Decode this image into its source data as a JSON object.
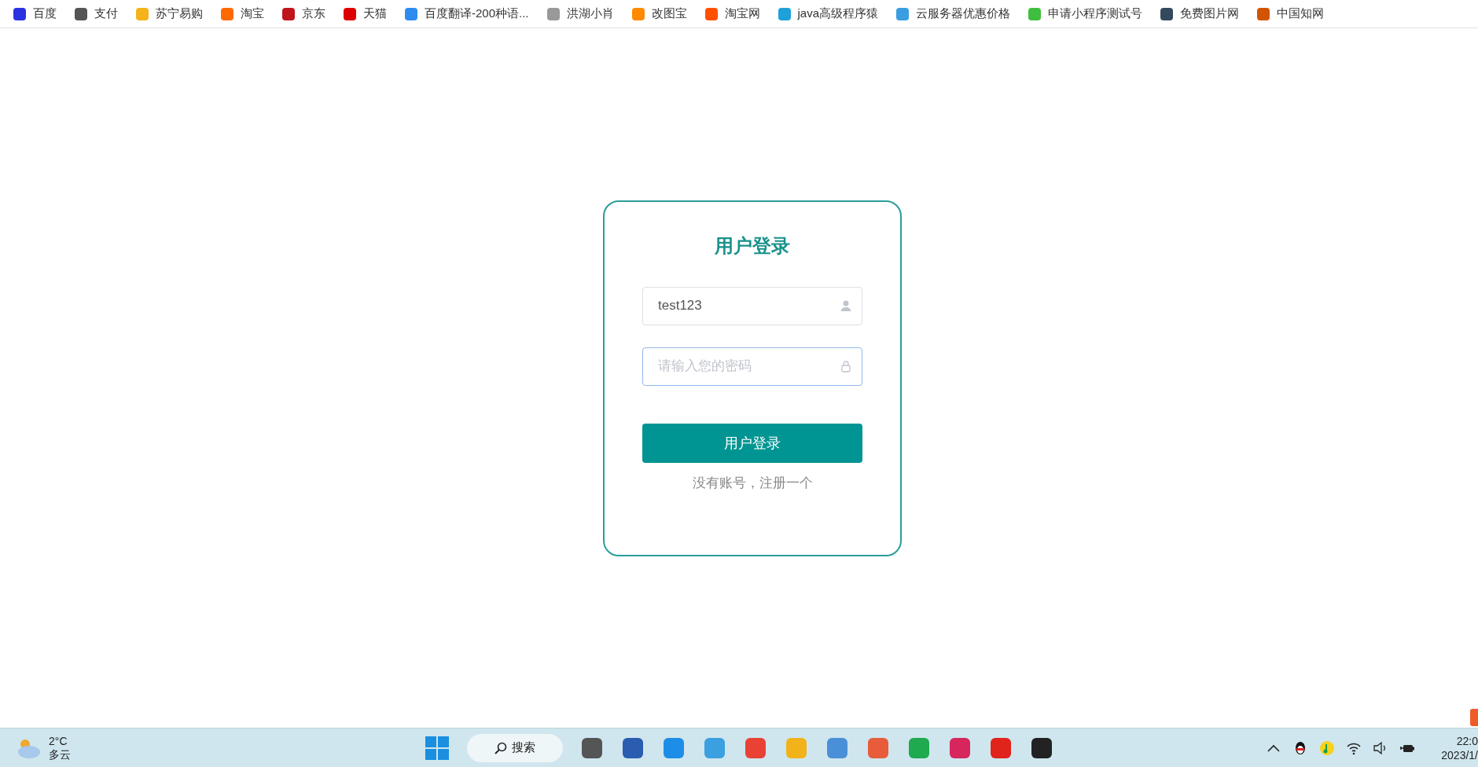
{
  "bookmarks": [
    {
      "label": "百度"
    },
    {
      "label": "支付"
    },
    {
      "label": "苏宁易购"
    },
    {
      "label": "淘宝"
    },
    {
      "label": "京东"
    },
    {
      "label": "天猫"
    },
    {
      "label": "百度翻译-200种语..."
    },
    {
      "label": "洪湖小肖"
    },
    {
      "label": "改图宝"
    },
    {
      "label": "淘宝网"
    },
    {
      "label": "java高级程序猿"
    },
    {
      "label": "云服务器优惠价格"
    },
    {
      "label": "申请小程序测试号"
    },
    {
      "label": "免费图片网"
    },
    {
      "label": "中国知网"
    }
  ],
  "login": {
    "title": "用户登录",
    "fields": [
      {
        "kind": "user",
        "value": "test123",
        "focused": false
      },
      {
        "kind": "password",
        "placeholder": "请输入您的密码",
        "focused": true
      }
    ],
    "submit": "用户登录",
    "register_link": "没有账号，注册一个"
  },
  "taskbar": {
    "weather": {
      "temperature": "2°C",
      "condition": "多云"
    },
    "search": "搜索",
    "clock": {
      "time": "22:0",
      "date": "2023/1/"
    }
  }
}
